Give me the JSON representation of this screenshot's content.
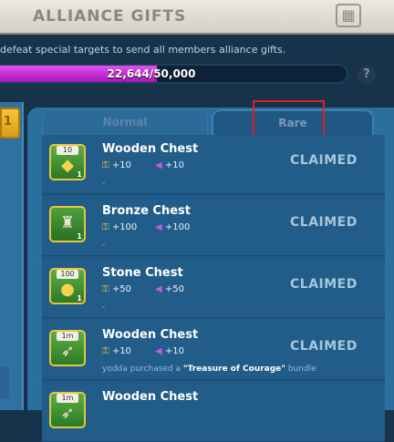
{
  "header": {
    "title": "ALLIANCE GIFTS"
  },
  "subtitle": "defeat special targets to send all members alliance gifts.",
  "progress": {
    "text": "22,644/50,000",
    "fraction": 0.453
  },
  "help": {
    "glyph": "?"
  },
  "ribbon": {
    "text": "1"
  },
  "tabs": {
    "normal": "Normal",
    "rare": "Rare"
  },
  "rows": [
    {
      "name": "Wooden Chest",
      "badge": "10",
      "qty": "1",
      "icon": "crystal-icon",
      "key": "+10",
      "gem": "+10",
      "note": "",
      "status": "CLAIMED"
    },
    {
      "name": "Bronze Chest",
      "badge": "",
      "qty": "1",
      "icon": "tower-icon",
      "key": "+100",
      "gem": "+100",
      "note": "",
      "status": "CLAIMED"
    },
    {
      "name": "Stone Chest",
      "badge": "100",
      "qty": "1",
      "icon": "coin-icon",
      "key": "+50",
      "gem": "+50",
      "note": "",
      "status": "CLAIMED"
    },
    {
      "name": "Wooden Chest",
      "badge": "1m",
      "qty": "",
      "icon": "scroll-icon",
      "key": "+10",
      "gem": "+10",
      "note_prefix": "yodda purchased a ",
      "note_bold": "\"Treasure of Courage\"",
      "note_suffix": " bundle",
      "status": "CLAIMED"
    },
    {
      "name": "Wooden Chest",
      "badge": "1m",
      "qty": "",
      "icon": "scroll-icon"
    }
  ]
}
